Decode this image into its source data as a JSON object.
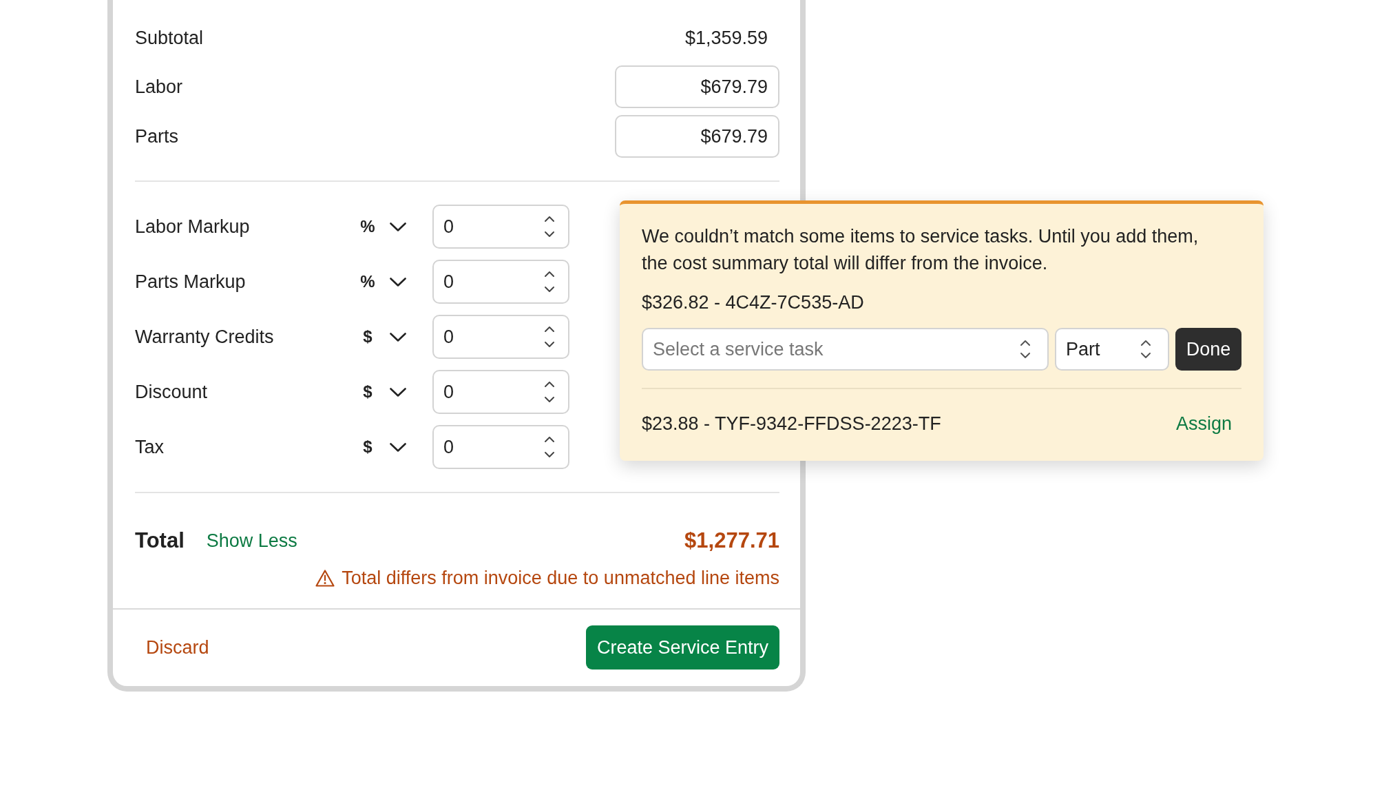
{
  "cost_summary": {
    "subtotal": {
      "label": "Subtotal",
      "value": "$1,359.59"
    },
    "amounts": [
      {
        "label": "Labor",
        "value": "$679.79"
      },
      {
        "label": "Parts",
        "value": "$679.79"
      }
    ],
    "adjustments": [
      {
        "label": "Labor Markup",
        "unit": "%",
        "value": "0"
      },
      {
        "label": "Parts Markup",
        "unit": "%",
        "value": "0"
      },
      {
        "label": "Warranty Credits",
        "unit": "$",
        "value": "0"
      },
      {
        "label": "Discount",
        "unit": "$",
        "value": "0"
      },
      {
        "label": "Tax",
        "unit": "$",
        "value": "0"
      }
    ],
    "total": {
      "label": "Total",
      "toggle": "Show Less",
      "value": "$1,277.71",
      "warning": "Total differs from invoice due to unmatched line items"
    }
  },
  "footer": {
    "discard": "Discard",
    "primary": "Create Service Entry"
  },
  "unmatched_popover": {
    "message": "We couldn’t match some items to service tasks. Until you add them, the cost summary total will differ from the invoice.",
    "items": [
      {
        "kind": "editing",
        "label": "$326.82 - 4C4Z-7C535-AD",
        "task_select": {
          "placeholder": "Select a service task"
        },
        "type_select": {
          "value": "Part"
        },
        "button": "Done"
      },
      {
        "kind": "collapsed",
        "label": "$23.88 - TYF-9342-FFDSS-2223-TF",
        "button": "Assign"
      }
    ]
  }
}
